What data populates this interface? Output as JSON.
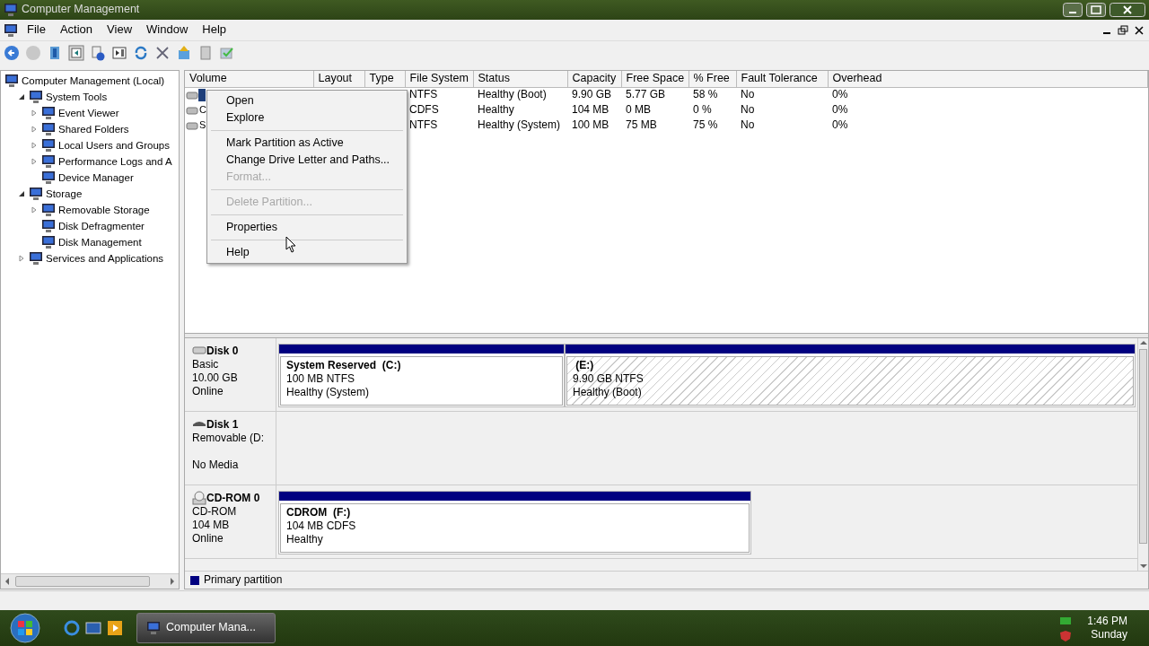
{
  "window": {
    "title": "Computer Management"
  },
  "menu_bar": [
    "File",
    "Action",
    "View",
    "Window",
    "Help"
  ],
  "tree": [
    {
      "label": "Computer Management (Local)",
      "children": [
        {
          "label": "System Tools",
          "expanded": true,
          "children": [
            {
              "label": "Event Viewer",
              "expanded": false
            },
            {
              "label": "Shared Folders",
              "expanded": false
            },
            {
              "label": "Local Users and Groups",
              "expanded": false
            },
            {
              "label": "Performance Logs and A",
              "expanded": false
            },
            {
              "label": "Device Manager"
            }
          ]
        },
        {
          "label": "Storage",
          "expanded": true,
          "children": [
            {
              "label": "Removable Storage",
              "expanded": false
            },
            {
              "label": "Disk Defragmenter"
            },
            {
              "label": "Disk Management"
            }
          ]
        },
        {
          "label": "Services and Applications",
          "expanded": false
        }
      ]
    }
  ],
  "volume_list": {
    "columns": [
      "Volume",
      "Layout",
      "Type",
      "File System",
      "Status",
      "Capacity",
      "Free Space",
      "% Free",
      "Fault Tolerance",
      "Overhead"
    ],
    "rows": [
      {
        "selected": true,
        "file_system": "NTFS",
        "status": "Healthy (Boot)",
        "capacity": "9.90 GB",
        "free_space": "5.77 GB",
        "percent_free": "58 %",
        "fault_tolerance": "No",
        "overhead": "0%"
      },
      {
        "selected": false,
        "volume": "C",
        "file_system": "CDFS",
        "status": "Healthy",
        "capacity": "104 MB",
        "free_space": "0 MB",
        "percent_free": "0 %",
        "fault_tolerance": "No",
        "overhead": "0%"
      },
      {
        "selected": false,
        "volume": "S",
        "file_system": "NTFS",
        "status": "Healthy (System)",
        "capacity": "100 MB",
        "free_space": "75 MB",
        "percent_free": "75 %",
        "fault_tolerance": "No",
        "overhead": "0%"
      }
    ]
  },
  "context_menu": [
    {
      "kind": "item",
      "label": "Open",
      "disabled": false
    },
    {
      "kind": "item",
      "label": "Explore",
      "disabled": false
    },
    {
      "kind": "separator"
    },
    {
      "kind": "item",
      "label": "Mark Partition as Active",
      "disabled": false
    },
    {
      "kind": "item",
      "label": "Change Drive Letter and Paths...",
      "disabled": false
    },
    {
      "kind": "item",
      "label": "Format...",
      "disabled": true
    },
    {
      "kind": "separator"
    },
    {
      "kind": "item",
      "label": "Delete Partition...",
      "disabled": true
    },
    {
      "kind": "separator"
    },
    {
      "kind": "item",
      "label": "Properties",
      "disabled": false
    },
    {
      "kind": "separator"
    },
    {
      "kind": "item",
      "label": "Help",
      "disabled": false
    }
  ],
  "disks": [
    {
      "kind": "disk",
      "name": "Disk 0",
      "type": "Basic",
      "size": "10.00 GB",
      "status": "Online",
      "partitions": [
        {
          "label": "System Reserved  (C:)",
          "detail": "100 MB NTFS",
          "status": "Healthy (System)",
          "selected": false
        },
        {
          "label": " (E:)",
          "detail": "9.90 GB NTFS",
          "status": "Healthy (Boot)",
          "selected": true
        }
      ]
    },
    {
      "kind": "removable",
      "name": "Disk 1",
      "type": "Removable (D:",
      "status": "No Media"
    },
    {
      "kind": "cdrom",
      "name": "CD-ROM 0",
      "type": "CD-ROM",
      "size": "104 MB",
      "status": "Online",
      "partitions": [
        {
          "label": "CDROM  (F:)",
          "detail": "104 MB CDFS",
          "status": "Healthy",
          "selected": false
        }
      ]
    }
  ],
  "legend": [
    {
      "label": "Primary partition",
      "color": "#000080"
    }
  ],
  "taskbar": {
    "buttons": [
      {
        "label": "Computer Mana..."
      }
    ],
    "clock": {
      "time": "1:46 PM",
      "day": "Sunday"
    }
  }
}
